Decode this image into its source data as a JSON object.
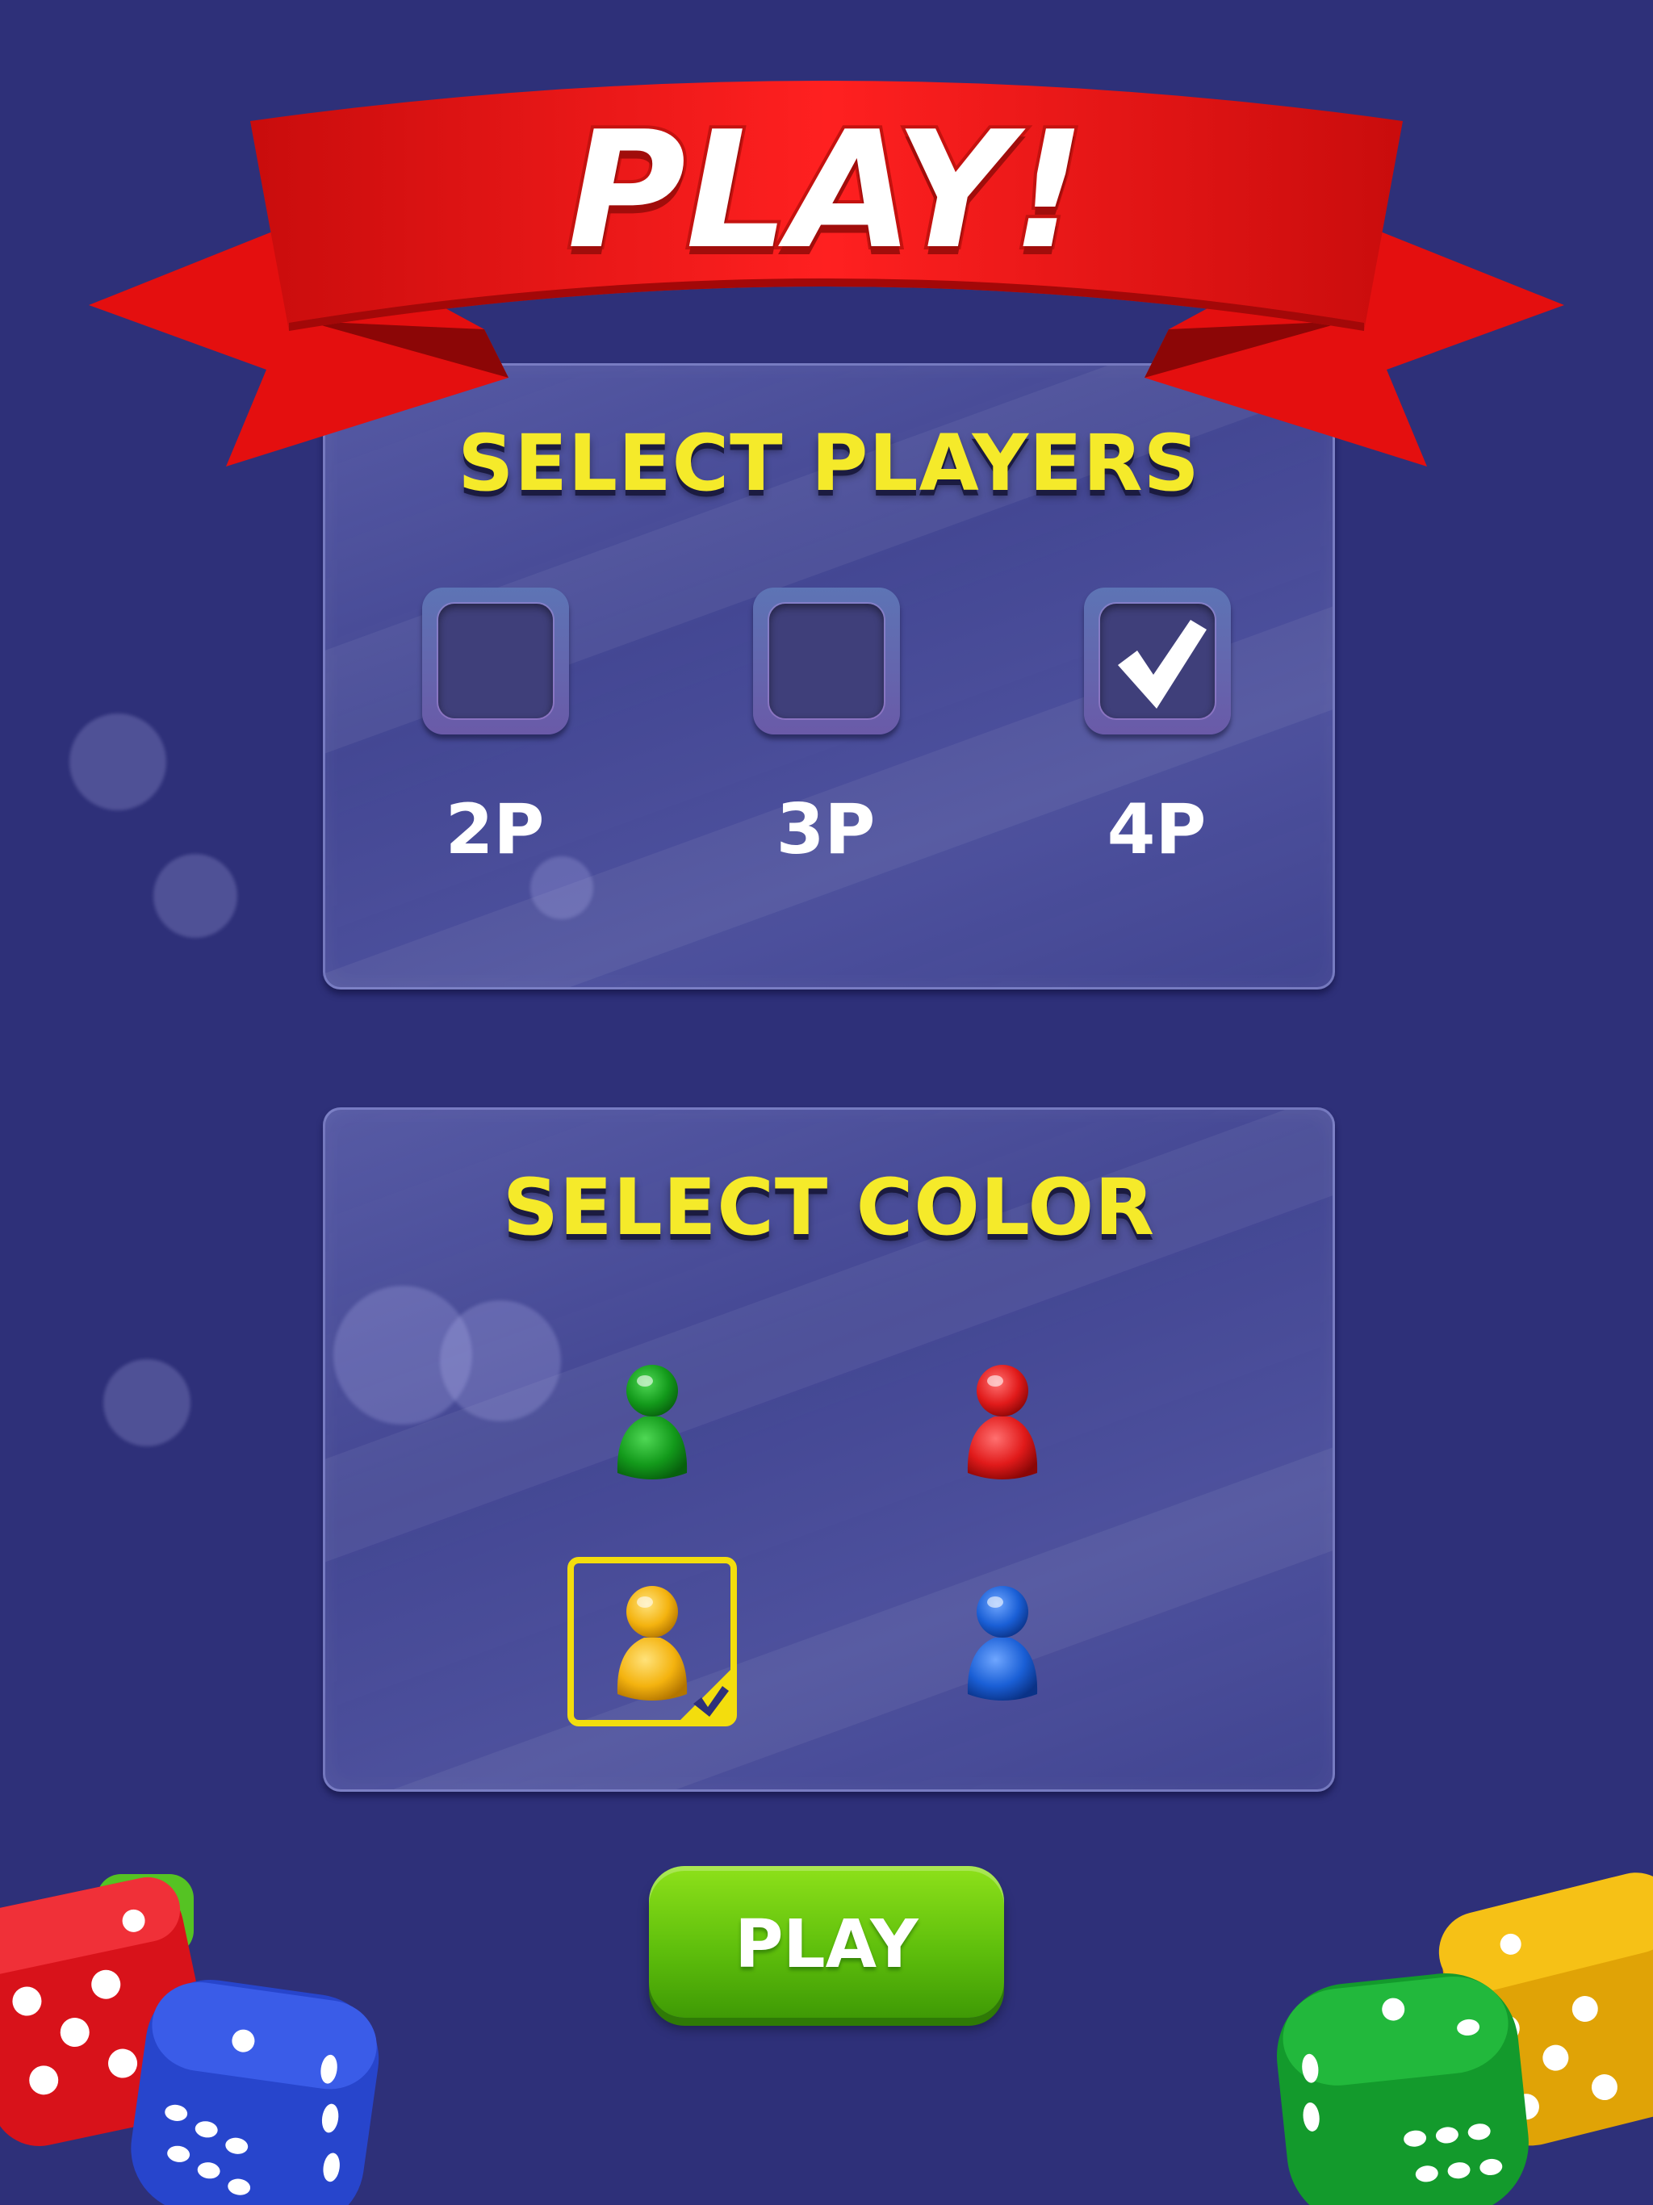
{
  "banner": {
    "title": "PLAY!"
  },
  "players_panel": {
    "title": "SELECT PLAYERS",
    "options": [
      {
        "label": "2P",
        "checked": false
      },
      {
        "label": "3P",
        "checked": false
      },
      {
        "label": "4P",
        "checked": true
      }
    ]
  },
  "color_panel": {
    "title": "SELECT COLOR",
    "pawns": [
      {
        "name": "green-pawn",
        "color": "#139a1b",
        "selected": false
      },
      {
        "name": "red-pawn",
        "color": "#e11a1a",
        "selected": false
      },
      {
        "name": "yellow-pawn",
        "color": "#f4b30f",
        "selected": true
      },
      {
        "name": "blue-pawn",
        "color": "#1a5fd6",
        "selected": false
      }
    ]
  },
  "play_button": {
    "label": "PLAY"
  },
  "colors": {
    "background": "#2e3079",
    "title_yellow": "#f5ea2a",
    "banner_red": "#e8100f",
    "play_green": "#6cc40f"
  }
}
